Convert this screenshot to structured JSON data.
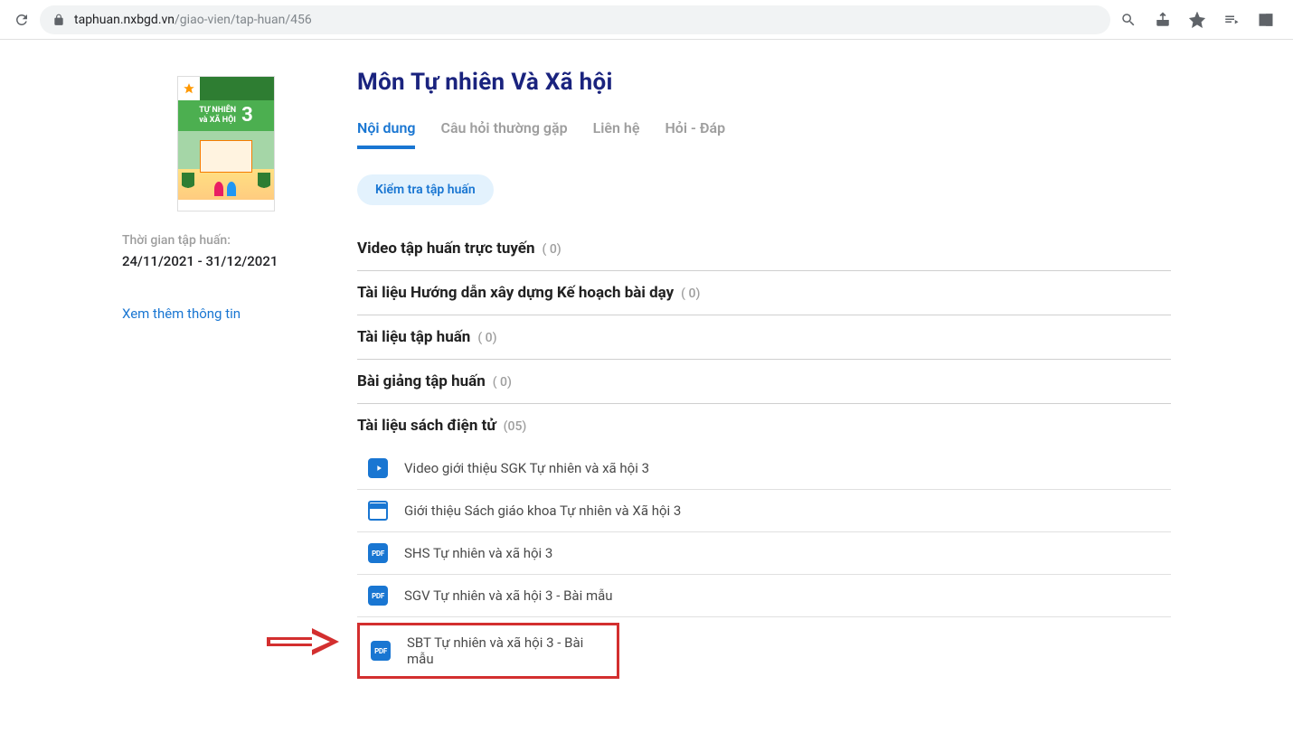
{
  "browser": {
    "url_domain": "taphuan.nxbgd.vn",
    "url_path": "/giao-vien/tap-huan/456"
  },
  "book": {
    "title_line1": "TỰ NHIÊN",
    "title_line2": "và XÃ HỘI",
    "grade": "3"
  },
  "sidebar": {
    "time_label": "Thời gian tập huấn:",
    "time_range": "24/11/2021 - 31/12/2021",
    "more_link": "Xem thêm thông tin"
  },
  "main": {
    "title": "Môn Tự nhiên Và Xã hội",
    "tabs": [
      {
        "label": "Nội dung",
        "active": true
      },
      {
        "label": "Câu hỏi thường gặp",
        "active": false
      },
      {
        "label": "Liên hệ",
        "active": false
      },
      {
        "label": "Hỏi - Đáp",
        "active": false
      }
    ],
    "check_button": "Kiểm tra tập huấn",
    "sections": [
      {
        "title": "Video tập huấn trực tuyến",
        "count": "( 0)"
      },
      {
        "title": "Tài liệu Hướng dẫn xây dựng Kế hoạch bài dạy",
        "count": "( 0)"
      },
      {
        "title": "Tài liệu tập huấn",
        "count": "( 0)"
      },
      {
        "title": "Bài giảng tập huấn",
        "count": "( 0)"
      },
      {
        "title": "Tài liệu sách điện tử",
        "count": "(05)"
      }
    ],
    "documents": [
      {
        "icon": "play",
        "label": "Video giới thiệu SGK Tự nhiên và xã hội 3"
      },
      {
        "icon": "browser",
        "label": "Giới thiệu Sách giáo khoa Tự nhiên và Xã hội 3"
      },
      {
        "icon": "pdf",
        "icon_text": "PDF",
        "label": "SHS Tự nhiên và xã hội 3"
      },
      {
        "icon": "pdf",
        "icon_text": "PDF",
        "label": "SGV Tự nhiên và xã hội 3 - Bài mẫu"
      },
      {
        "icon": "pdf",
        "icon_text": "PDF",
        "label": "SBT Tự nhiên và xã hội 3 - Bài mẫu",
        "highlighted": true
      }
    ]
  }
}
